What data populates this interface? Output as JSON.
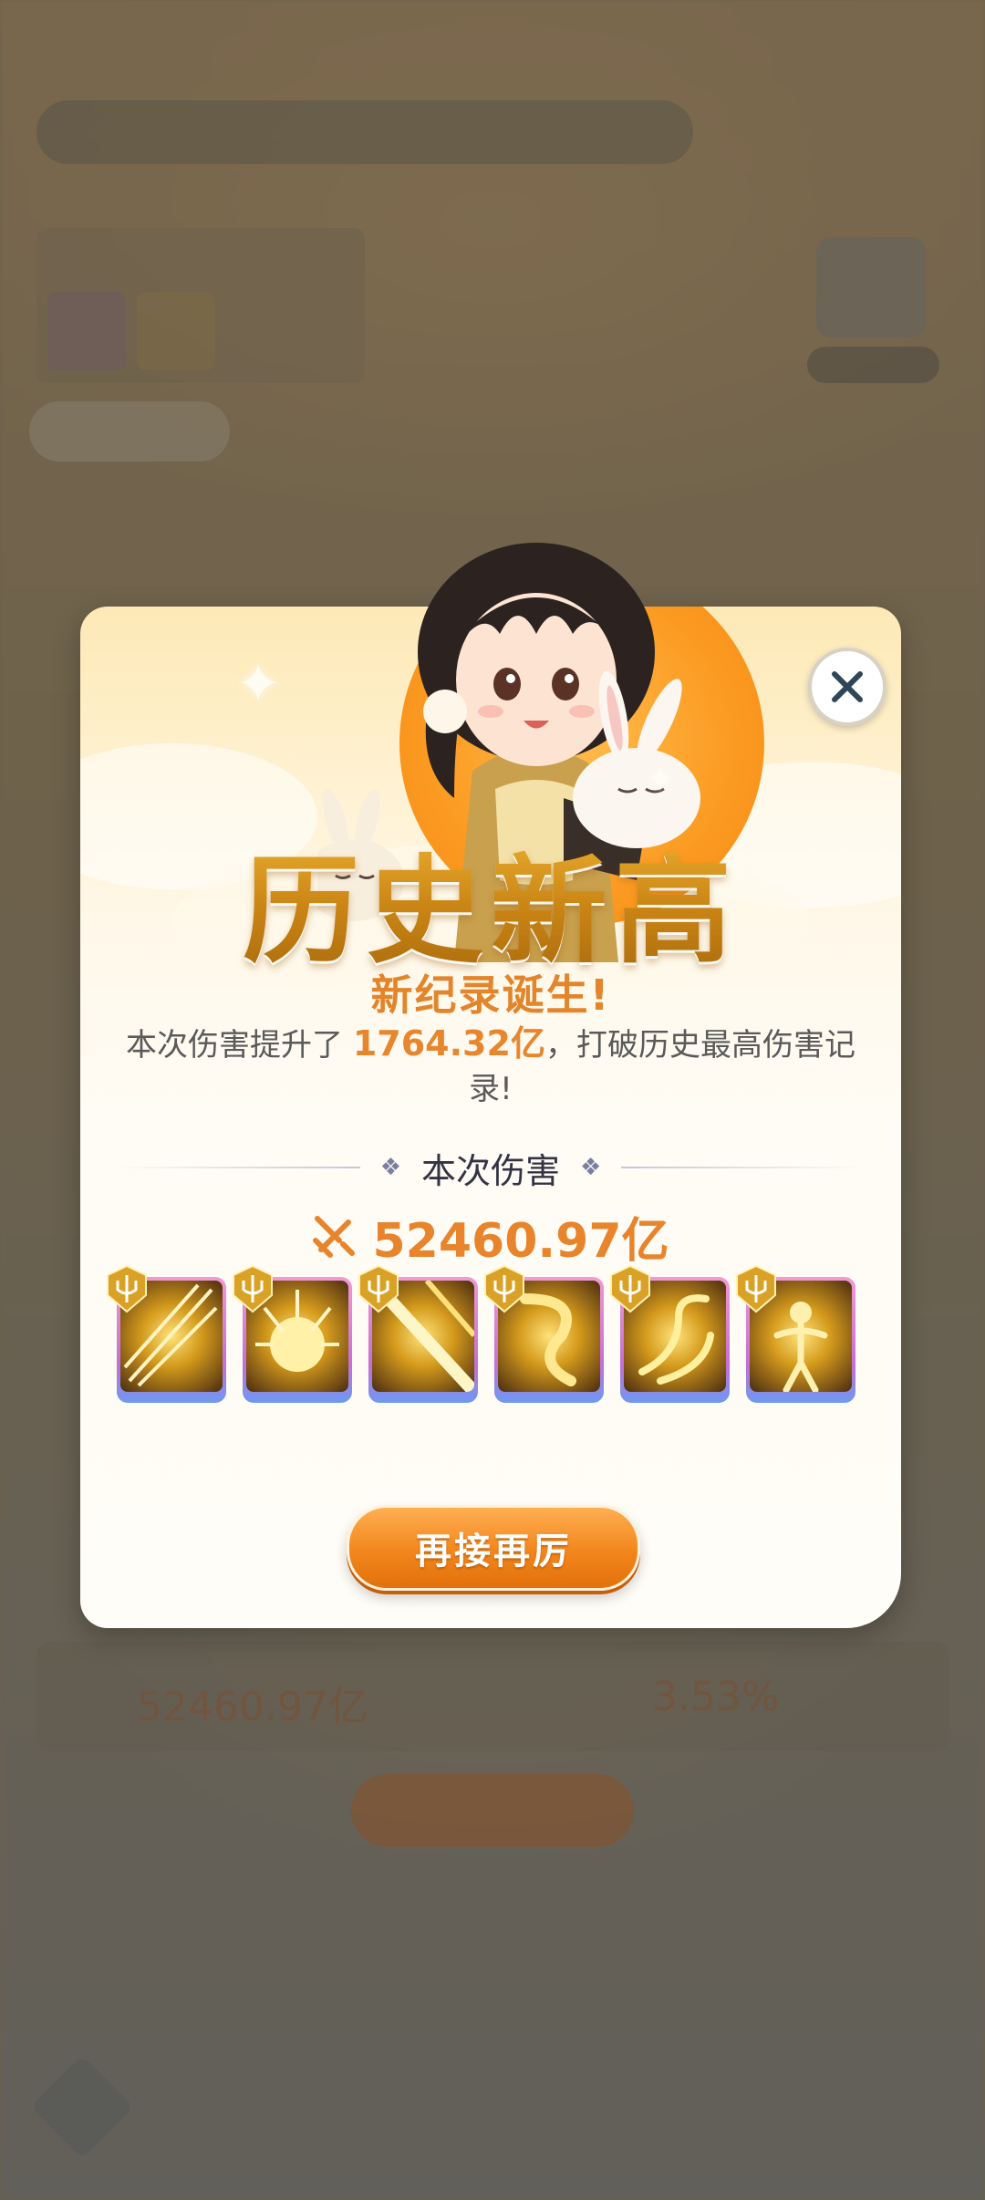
{
  "background": {
    "damage_value": "52460.97亿",
    "percent_value": "3.53%"
  },
  "modal": {
    "title": "历史新高",
    "subtitle": "新纪录诞生!",
    "description_prefix": "本次伤害提升了 ",
    "description_highlight": "1764.32亿",
    "description_suffix": "，打破历史最高伤害记录!",
    "section_label": "本次伤害",
    "damage_value": "52460.97亿",
    "skills": [
      {
        "name": "golden-spears-skill-icon"
      },
      {
        "name": "golden-burst-skill-icon"
      },
      {
        "name": "golden-beam-skill-icon"
      },
      {
        "name": "golden-dragon-skill-icon"
      },
      {
        "name": "golden-phoenix-skill-icon"
      },
      {
        "name": "golden-dancer-skill-icon"
      }
    ],
    "retry_button": "再接再厉"
  },
  "colors": {
    "accent_orange": "#e8842b",
    "title_gold": "#c98714"
  }
}
